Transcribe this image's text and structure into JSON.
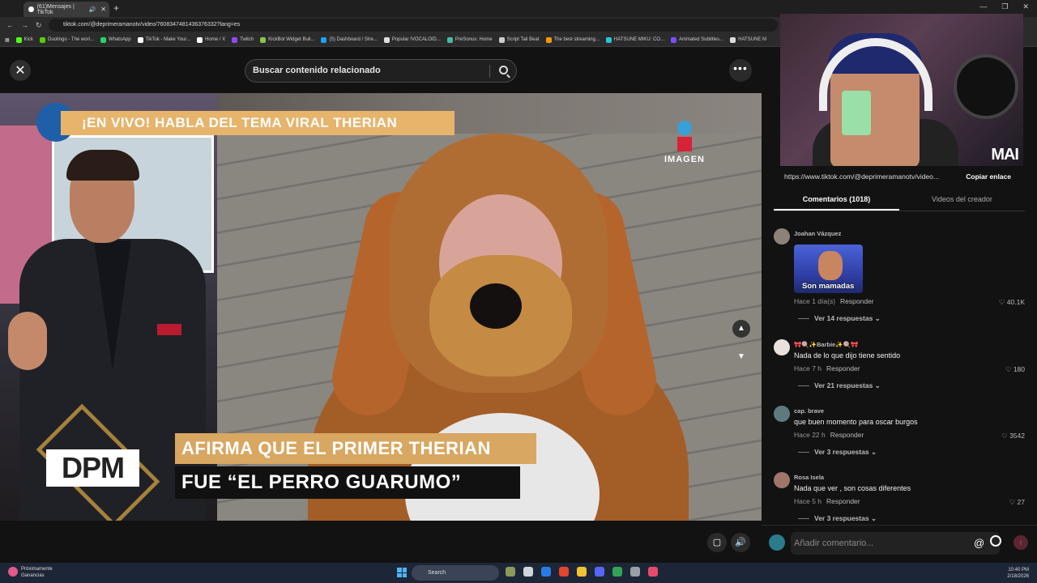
{
  "browser": {
    "tab_title": "(61)Mensajes | TikTok",
    "url": "tiktok.com/@deprimeramanotv/video/7608347481436376332?lang=es",
    "bookmarks": [
      "Kick",
      "Duolingo - The worl...",
      "WhatsApp",
      "TikTok - Make Your...",
      "Home / X",
      "Twitch",
      "KickBot Widget Buil...",
      "(5) Dashboard / Stre...",
      "Popular !VOCALOID...",
      "PreSonus: Home",
      "Script Tail Beat",
      "The best streaming...",
      "HATSUNE MIKU: CO...",
      "Animated Subtitles...",
      "HATSUNE M"
    ]
  },
  "search": {
    "placeholder": "Buscar contenido relacionado"
  },
  "video": {
    "banner_top": "¡EN VIVO! HABLA DEL TEMA VIRAL THERIAN",
    "channel_logo": "IMAGEN",
    "show_logo": "DPM",
    "lower_third_1": "AFIRMA QUE EL PRIMER THERIAN",
    "lower_third_2": "FUE “EL PERRO GUARUMO”"
  },
  "webcam": {
    "tag": "MAI"
  },
  "share": {
    "link": "https://www.tiktok.com/@deprimeramanotv/video...",
    "copy_label": "Copiar enlace"
  },
  "tabs": {
    "comments": "Comentarios (1018)",
    "creator_videos": "Videos del creador"
  },
  "comments": [
    {
      "user": "Joahan Vázquez",
      "text": "",
      "sticker_text": "Son mamadas",
      "time": "Hace 1 día(s)",
      "reply_label": "Responder",
      "likes": "40.1K",
      "replies": "Ver 14 respuestas"
    },
    {
      "user": "🎀🍭✨Barbie✨🍭🎀",
      "text": "Nada de lo que dijo tiene sentido",
      "time": "Hace 7 h",
      "reply_label": "Responder",
      "likes": "180",
      "replies": "Ver 21 respuestas"
    },
    {
      "user": "cap. brave",
      "text": "que buen momento para oscar burgos",
      "time": "Hace 22 h",
      "reply_label": "Responder",
      "likes": "3542",
      "replies": "Ver 3 respuestas"
    },
    {
      "user": "Rosa Isela",
      "text": "Nada que ver , son cosas diferentes",
      "time": "Hace 5 h",
      "reply_label": "Responder",
      "likes": "27",
      "replies": "Ver 3 respuestas"
    }
  ],
  "comment_input": {
    "placeholder": "Añadir comentario..."
  },
  "taskbar": {
    "widget_title": "Próximamente",
    "widget_sub": "Ganancias",
    "search_label": "Search",
    "time": "10:40 PM",
    "date": "2/18/2026"
  },
  "colors": {
    "accent_red": "#fe2c55",
    "banner_gold": "#e7b46c",
    "panel_bg": "#121212"
  }
}
